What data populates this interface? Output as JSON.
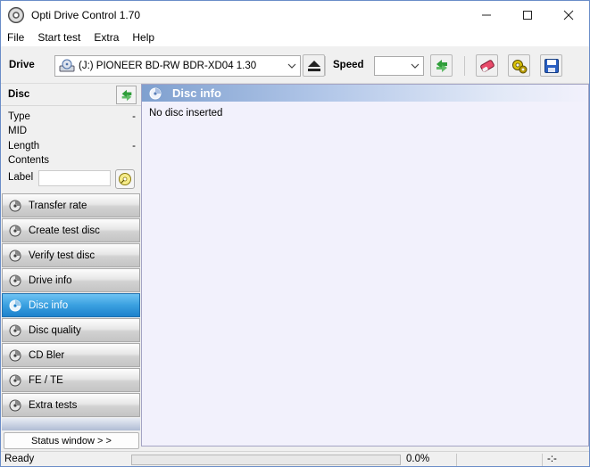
{
  "window": {
    "title": "Opti Drive Control 1.70"
  },
  "menu": [
    "File",
    "Start test",
    "Extra",
    "Help"
  ],
  "toolbar": {
    "drive_label": "Drive",
    "drive_value": "(J:)   PIONEER BD-RW   BDR-XD04 1.30",
    "speed_label": "Speed",
    "speed_value": ""
  },
  "disc": {
    "title": "Disc",
    "properties": [
      {
        "label": "Type",
        "value": "-"
      },
      {
        "label": "MID",
        "value": ""
      },
      {
        "label": "Length",
        "value": "-"
      },
      {
        "label": "Contents",
        "value": ""
      }
    ],
    "label_field": "Label"
  },
  "nav": {
    "items": [
      {
        "label": "Transfer rate",
        "active": false
      },
      {
        "label": "Create test disc",
        "active": false
      },
      {
        "label": "Verify test disc",
        "active": false
      },
      {
        "label": "Drive info",
        "active": false
      },
      {
        "label": "Disc info",
        "active": true
      },
      {
        "label": "Disc quality",
        "active": false
      },
      {
        "label": "CD Bler",
        "active": false
      },
      {
        "label": "FE / TE",
        "active": false
      },
      {
        "label": "Extra tests",
        "active": false
      }
    ],
    "status_window": "Status window > >"
  },
  "content": {
    "title": "Disc info",
    "message": "No disc inserted"
  },
  "statusbar": {
    "text": "Ready",
    "progress_percent": 0,
    "progress_text": "0.0%",
    "time": "-:-"
  },
  "colors": {
    "accent": "#1d82cc",
    "header_gradient": "#7fa0cf"
  }
}
